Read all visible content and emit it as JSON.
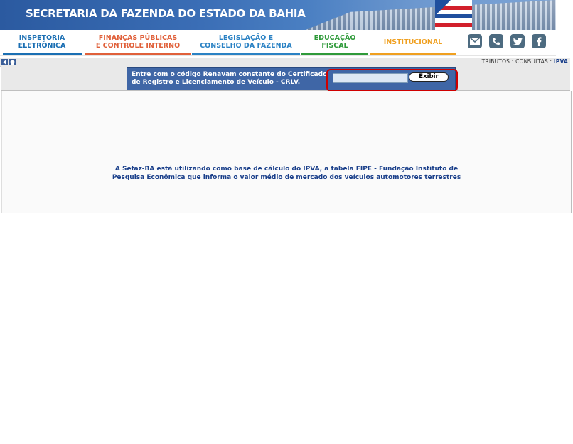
{
  "header": {
    "title": "SECRETARIA DA FAZENDA DO ESTADO DA BAHIA",
    "colors": {
      "banner": "#3a6db5"
    }
  },
  "nav": {
    "items": [
      {
        "label": "INSPETORIA\nELETRÔNICA",
        "color": "#1b6fb3"
      },
      {
        "label": "FINANÇAS PÚBLICAS\nE CONTROLE INTERNO",
        "color": "#e0603a"
      },
      {
        "label": "LEGISLAÇÃO E\nCONSELHO DA FAZENDA",
        "color": "#2b82c4"
      },
      {
        "label": "EDUCAÇÃO\nFISCAL",
        "color": "#2f9a3a"
      },
      {
        "label": "INSTITUCIONAL",
        "color": "#f0a020"
      }
    ],
    "social": [
      "mail-icon",
      "phone-icon",
      "twitter-icon",
      "facebook-icon"
    ]
  },
  "breadcrumb": {
    "part1": "TRIBUTOS",
    "sep": " : ",
    "part2": "CONSULTAS",
    "current": "IPVA"
  },
  "form": {
    "label_line1": "Entre com o código Renavam constante do Certificado",
    "label_line2": "de Registro e Licenciamento de Veículo - CRLV.",
    "input_value": "",
    "button_label": "Exibir"
  },
  "content": {
    "info_text": "A Sefaz-BA está utilizando como base de cálculo do IPVA, a tabela FIPE - Fundação Instituto de\nPesquisa Econômica que informa o valor médio de mercado dos veículos automotores terrestres"
  }
}
